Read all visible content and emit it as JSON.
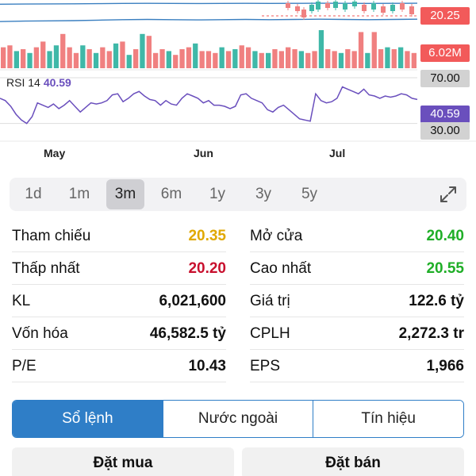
{
  "chart": {
    "price_tag": "20.25",
    "volume_tag": "6.02M",
    "rsi_label": "RSI 14",
    "rsi_value": "40.59",
    "rsi_upper": "70.00",
    "rsi_lower": "30.00",
    "months": [
      "May",
      "Jun",
      "Jul"
    ]
  },
  "chart_data": {
    "type": "bar",
    "volume_colors": {
      "up": "#3fb8a8",
      "down": "#f08080"
    },
    "volume_bars": [
      {
        "v": 0.55,
        "up": false
      },
      {
        "v": 0.6,
        "up": false
      },
      {
        "v": 0.45,
        "up": true
      },
      {
        "v": 0.5,
        "up": false
      },
      {
        "v": 0.4,
        "up": true
      },
      {
        "v": 0.55,
        "up": false
      },
      {
        "v": 0.7,
        "up": false
      },
      {
        "v": 0.45,
        "up": true
      },
      {
        "v": 0.6,
        "up": true
      },
      {
        "v": 0.9,
        "up": false
      },
      {
        "v": 0.55,
        "up": false
      },
      {
        "v": 0.4,
        "up": false
      },
      {
        "v": 0.6,
        "up": true
      },
      {
        "v": 0.5,
        "up": false
      },
      {
        "v": 0.4,
        "up": true
      },
      {
        "v": 0.55,
        "up": false
      },
      {
        "v": 0.45,
        "up": false
      },
      {
        "v": 0.65,
        "up": true
      },
      {
        "v": 0.7,
        "up": false
      },
      {
        "v": 0.35,
        "up": true
      },
      {
        "v": 0.5,
        "up": false
      },
      {
        "v": 0.9,
        "up": true
      },
      {
        "v": 0.85,
        "up": false
      },
      {
        "v": 0.4,
        "up": false
      },
      {
        "v": 0.5,
        "up": false
      },
      {
        "v": 0.45,
        "up": true
      },
      {
        "v": 0.35,
        "up": false
      },
      {
        "v": 0.5,
        "up": false
      },
      {
        "v": 0.55,
        "up": false
      },
      {
        "v": 0.65,
        "up": true
      },
      {
        "v": 0.45,
        "up": false
      },
      {
        "v": 0.45,
        "up": false
      },
      {
        "v": 0.4,
        "up": false
      },
      {
        "v": 0.55,
        "up": true
      },
      {
        "v": 0.45,
        "up": false
      },
      {
        "v": 0.5,
        "up": true
      },
      {
        "v": 0.6,
        "up": false
      },
      {
        "v": 0.55,
        "up": false
      },
      {
        "v": 0.45,
        "up": true
      },
      {
        "v": 0.4,
        "up": false
      },
      {
        "v": 0.4,
        "up": true
      },
      {
        "v": 0.5,
        "up": false
      },
      {
        "v": 0.45,
        "up": false
      },
      {
        "v": 0.55,
        "up": false
      },
      {
        "v": 0.5,
        "up": false
      },
      {
        "v": 0.45,
        "up": true
      },
      {
        "v": 0.4,
        "up": false
      },
      {
        "v": 0.45,
        "up": false
      },
      {
        "v": 1.0,
        "up": true
      },
      {
        "v": 0.5,
        "up": false
      },
      {
        "v": 0.45,
        "up": false
      },
      {
        "v": 0.4,
        "up": true
      },
      {
        "v": 0.5,
        "up": false
      },
      {
        "v": 0.45,
        "up": false
      },
      {
        "v": 0.95,
        "up": false
      },
      {
        "v": 0.4,
        "up": true
      },
      {
        "v": 0.95,
        "up": false
      },
      {
        "v": 0.5,
        "up": false
      },
      {
        "v": 0.55,
        "up": true
      },
      {
        "v": 0.5,
        "up": false
      },
      {
        "v": 0.55,
        "up": true
      },
      {
        "v": 0.45,
        "up": false
      },
      {
        "v": 0.4,
        "up": false
      }
    ],
    "rsi": [
      52,
      50,
      45,
      38,
      33,
      30,
      36,
      48,
      46,
      44,
      47,
      43,
      46,
      50,
      45,
      40,
      44,
      48,
      47,
      48,
      50,
      55,
      56,
      49,
      52,
      56,
      58,
      54,
      51,
      50,
      46,
      50,
      47,
      46,
      52,
      56,
      54,
      52,
      48,
      50,
      46,
      46,
      45,
      43,
      45,
      55,
      56,
      52,
      50,
      48,
      42,
      40,
      44,
      46,
      42,
      38,
      34,
      33,
      32,
      56,
      50,
      48,
      49,
      52,
      62,
      60,
      58,
      56,
      60,
      55,
      54,
      52,
      54,
      53,
      54,
      56,
      55,
      52,
      51
    ],
    "price_line": [
      94,
      92,
      91,
      90,
      88,
      86,
      85,
      86,
      87,
      86,
      85,
      86,
      85,
      84,
      85,
      86,
      85,
      84
    ]
  },
  "ranges": [
    "1d",
    "1m",
    "3m",
    "6m",
    "1y",
    "3y",
    "5y"
  ],
  "active_range": "3m",
  "stats": {
    "left": [
      {
        "label": "Tham chiếu",
        "value": "20.35",
        "color": "yellow"
      },
      {
        "label": "Thấp nhất",
        "value": "20.20",
        "color": "red"
      },
      {
        "label": "KL",
        "value": "6,021,600",
        "color": "black"
      },
      {
        "label": "Vốn hóa",
        "value": "46,582.5 tỷ",
        "color": "black"
      },
      {
        "label": "P/E",
        "value": "10.43",
        "color": "black"
      }
    ],
    "right": [
      {
        "label": "Mở cửa",
        "value": "20.40",
        "color": "green"
      },
      {
        "label": "Cao nhất",
        "value": "20.55",
        "color": "green"
      },
      {
        "label": "Giá trị",
        "value": "122.6 tỷ",
        "color": "black"
      },
      {
        "label": "CPLH",
        "value": "2,272.3 tr",
        "color": "black"
      },
      {
        "label": "EPS",
        "value": "1,966",
        "color": "black"
      }
    ]
  },
  "segments": [
    "Sổ lệnh",
    "Nước ngoài",
    "Tín hiệu"
  ],
  "active_segment": "Sổ lệnh",
  "actions": {
    "buy": "Đặt mua",
    "sell": "Đặt bán"
  }
}
